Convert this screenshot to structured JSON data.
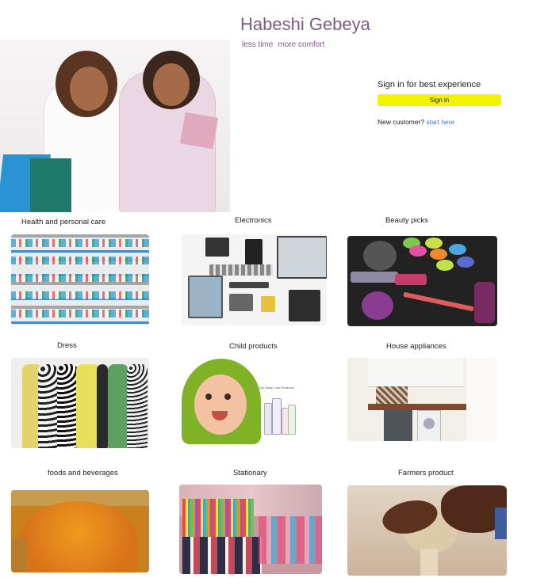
{
  "header": {
    "title": "Habeshi Gebeya",
    "tagline": [
      "less time",
      "more comfort"
    ]
  },
  "signin": {
    "heading": "Sign in for best experience",
    "button_label": "Sign in",
    "new_customer_text": "New customer?",
    "start_link": "start here",
    "button_color": "#f4f200"
  },
  "categories": [
    {
      "label": "Health and personal care",
      "icon": "health-care-image"
    },
    {
      "label": "Electronics",
      "icon": "electronics-image"
    },
    {
      "label": "Beauty picks",
      "icon": "beauty-image"
    },
    {
      "label": "Dress",
      "icon": "dress-image"
    },
    {
      "label": "Child products",
      "icon": "child-products-image"
    },
    {
      "label": "House appliances",
      "icon": "house-appliances-image"
    },
    {
      "label": "foods and beverages",
      "icon": "foods-image"
    },
    {
      "label": "Stationary",
      "icon": "stationary-image"
    },
    {
      "label": "Farmers product",
      "icon": "farmers-image"
    }
  ],
  "child_image_caption": "Our Baby Care Products"
}
